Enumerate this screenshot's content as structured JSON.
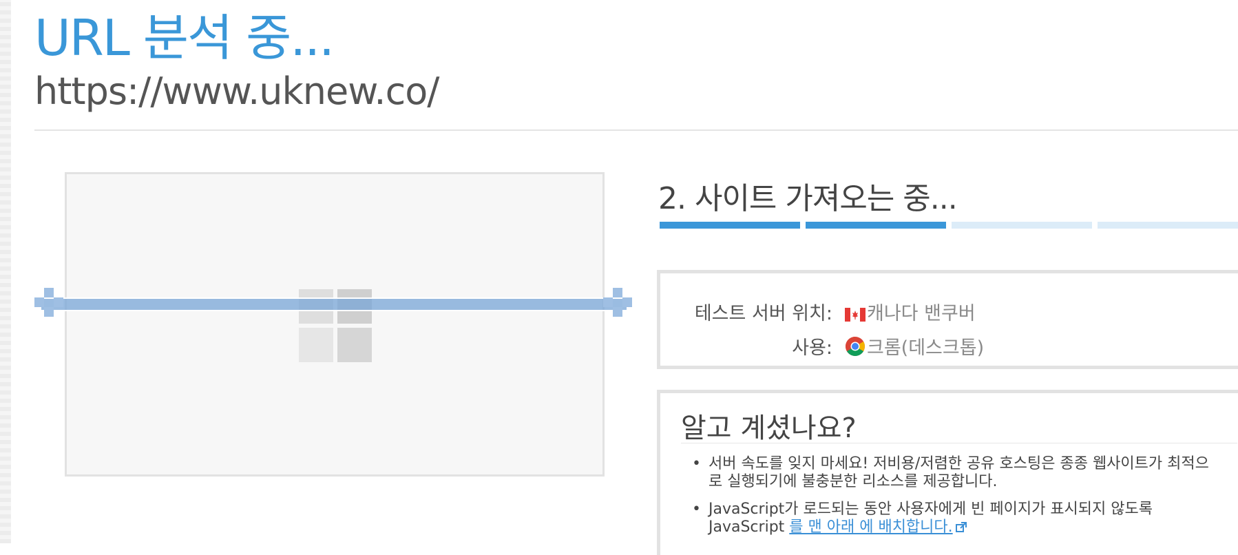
{
  "page": {
    "title": "URL 분석 중...",
    "url": "https://www.uknew.co/"
  },
  "status": {
    "step_title": "2. 사이트 가져오는 중...",
    "steps_total": 4,
    "steps_done": 2,
    "colors": {
      "done": "#3b97d9",
      "pending": "#dcecf8",
      "accent": "#3a97d8"
    }
  },
  "test_info": {
    "location_label": "테스트 서버 위치:",
    "location_value": "캐나다 밴쿠버",
    "location_icon": "canada-flag-icon",
    "browser_label": "사용:",
    "browser_value": "크롬(데스크톱)",
    "browser_icon": "chrome-icon"
  },
  "did_you_know": {
    "title": "알고 계셨나요?",
    "tips": [
      {
        "text": "서버 속도를 잊지 마세요! 저비용/저렴한 공유 호스팅은 종종 웹사이트가 최적으로 실행되기에 불충분한 리소스를 제공합니다."
      },
      {
        "text_before": "JavaScript가 로드되는 동안 사용자에게 빈 페이지가 표시되지 않도록 JavaScript ",
        "link": "를 맨 아래 에 배치합니다.",
        "link_icon": "external-link-icon"
      }
    ]
  }
}
